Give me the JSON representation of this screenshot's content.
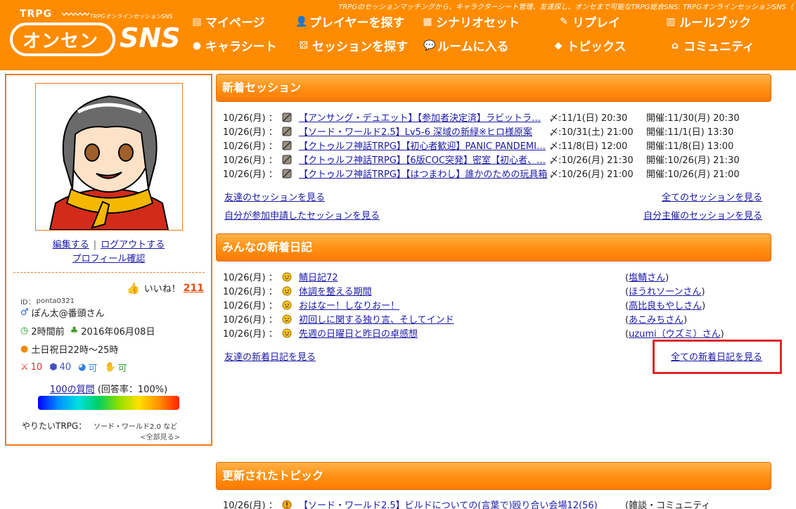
{
  "header": {
    "tagline": "TRPGのセッションマッチングから、キャラクターシート管理、友達探し、オンセまで可能なTRPG総合SNS: TRPGオンラインセッションSNS（",
    "logo_small": "TRPG",
    "logo_sub": "TRPGオンラインセッションSNS",
    "logo_main": "オンセン",
    "logo_sns": "SNS",
    "nav": [
      {
        "label": "マイページ",
        "icon": "mypage-icon"
      },
      {
        "label": "プレイヤーを探す",
        "icon": "player-search-icon"
      },
      {
        "label": "シナリオセット",
        "icon": "scenario-icon"
      },
      {
        "label": "リプレイ",
        "icon": "replay-icon"
      },
      {
        "label": "ルールブック",
        "icon": "rulebook-icon"
      },
      {
        "label": "キャラシート",
        "icon": "charsheet-icon"
      },
      {
        "label": "セッションを探す",
        "icon": "session-search-icon"
      },
      {
        "label": "ルームに入る",
        "icon": "room-icon"
      },
      {
        "label": "トピックス",
        "icon": "topics-icon"
      },
      {
        "label": "コミュニティ",
        "icon": "community-icon"
      }
    ]
  },
  "profile": {
    "edit": "編集する",
    "sep": "|",
    "logout": "ログアウトする",
    "confirm": "プロフィール確認",
    "like_label": "いいね！",
    "like_count": "211",
    "id_label": "ID：",
    "id_value": "ponta0321",
    "gender_mark": "♂",
    "name": "ぽん太@番頭さん",
    "last_login": "2時間前",
    "joined": "2016年06月08日",
    "play_time": "土日祝日22時～25時",
    "stats": [
      "10",
      "40",
      "可",
      "可"
    ],
    "question_link": "100の質問",
    "question_rate": "(回答率：100%)",
    "want_label": "やりたいTRPG：",
    "want_game": "ソード・ワールド2.0 など",
    "want_all": "<全部見る>"
  },
  "sessions": {
    "heading": "新着セッション",
    "rows": [
      {
        "date": "10/26(月) ：",
        "title": "【アンサング・デュエット】【参加者決定済】ラビットラ…",
        "deadline": "〆:11/1(日) 20:30",
        "held": "開催:11/30(月) 20:30"
      },
      {
        "date": "10/26(月) ：",
        "title": "【ソード・ワールド2.5】Lv5-6 深域の新緑※ヒロ様原案",
        "deadline": "〆:10/31(土) 21:00",
        "held": "開催:11/1(日) 13:30"
      },
      {
        "date": "10/26(月) ：",
        "title": "【クトゥルフ神話TRPG】【初心者歓迎】PANIC PANDEMI…",
        "deadline": "〆:11/8(日) 12:00",
        "held": "開催:11/8(日) 13:00"
      },
      {
        "date": "10/26(月) ：",
        "title": "【クトゥルフ神話TRPG】【6版COC突発】密室【初心者、…",
        "deadline": "〆:10/26(月) 21:30",
        "held": "開催:10/26(月) 21:30"
      },
      {
        "date": "10/26(月) ：",
        "title": "【クトゥルフ神話TRPG】【はつまわし】誰かのための玩具箱",
        "deadline": "〆:10/26(月) 21:00",
        "held": "開催:10/26(月) 21:00"
      }
    ],
    "friends_link": "友達のセッションを見る",
    "all_link": "全てのセッションを見る",
    "applied_link": "自分が参加申請したセッションを見る",
    "hosted_link": "自分主催のセッションを見る"
  },
  "diaries": {
    "heading": "みんなの新着日記",
    "rows": [
      {
        "date": "10/26(月) ：",
        "mood": "smile",
        "title": "鯖日記72",
        "author": "塩鯖さん"
      },
      {
        "date": "10/26(月) ：",
        "mood": "smile",
        "title": "体調を整える期間",
        "author": "ほうれソーンさん"
      },
      {
        "date": "10/26(月) ：",
        "mood": "smile",
        "title": "おはなー！しなりおー！",
        "author": "高比良もやしさん"
      },
      {
        "date": "10/26(月) ：",
        "mood": "worried",
        "title": "初回しに関する独り言、そしてインド",
        "author": "あこみちさん"
      },
      {
        "date": "10/26(月) ：",
        "mood": "smile",
        "title": "先週の日曜日と昨日の卓感想",
        "author": "uzumi（ウズミ）さん"
      }
    ],
    "paren_open": "(",
    "paren_close": ")",
    "friends_link": "友達の新着日記を見る",
    "all_link": "全ての新着日記を見る"
  },
  "topics": {
    "heading": "更新されたトピック",
    "rows": [
      {
        "date": "10/26(月) ：",
        "title": "【ソード・ワールド2.5】ビルドについての(言葉で)殴り合い会場12(56)",
        "category": "(雑談・コミュニティ"
      }
    ]
  },
  "colors": {
    "brand_orange": "#ff8c00",
    "link": "#1a1aa6",
    "highlight": "#e0262a"
  }
}
